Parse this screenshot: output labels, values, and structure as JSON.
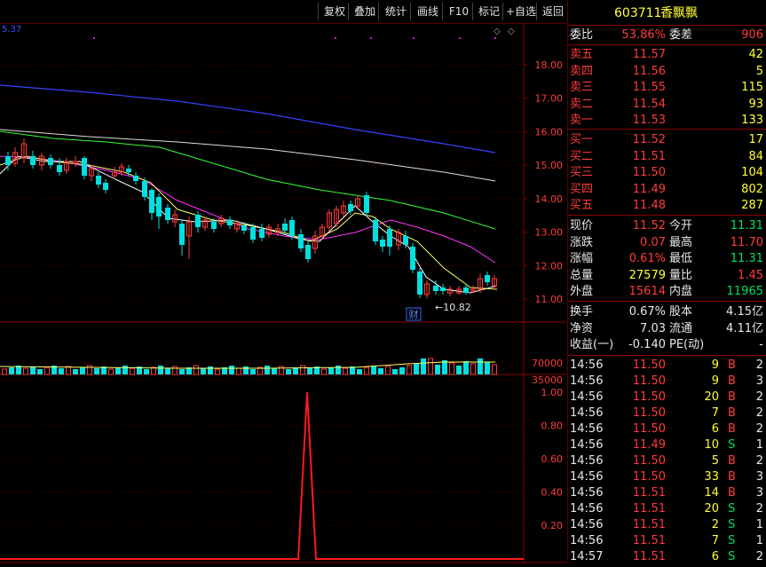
{
  "toolbar": {
    "buttons": [
      "复权",
      "叠加",
      "统计",
      "画线",
      "F10",
      "标记",
      "+自选",
      "返回"
    ]
  },
  "chart": {
    "top_left_value": "5.37",
    "price_axis": [
      "18.00",
      "17.00",
      "16.00",
      "15.00",
      "14.00",
      "13.00",
      "12.00",
      "11.00"
    ],
    "low_annotation": "←10.82",
    "cai_badge": "财",
    "volume_axis": [
      "70000",
      "35000"
    ],
    "indicator_axis": [
      "1.00",
      "0.80",
      "0.60",
      "0.40",
      "0.20"
    ]
  },
  "stock": {
    "code": "603711",
    "name": "香飘飘"
  },
  "order_ratio": {
    "label1": "委比",
    "value1": "53.86%",
    "label2": "委差",
    "value2": "906"
  },
  "asks": [
    {
      "label": "卖五",
      "price": "11.57",
      "volume": "42"
    },
    {
      "label": "卖四",
      "price": "11.56",
      "volume": "5"
    },
    {
      "label": "卖三",
      "price": "11.55",
      "volume": "115"
    },
    {
      "label": "卖二",
      "price": "11.54",
      "volume": "93"
    },
    {
      "label": "卖一",
      "price": "11.53",
      "volume": "133"
    }
  ],
  "bids": [
    {
      "label": "买一",
      "price": "11.52",
      "volume": "17"
    },
    {
      "label": "买二",
      "price": "11.51",
      "volume": "84"
    },
    {
      "label": "买三",
      "price": "11.50",
      "volume": "104"
    },
    {
      "label": "买四",
      "price": "11.49",
      "volume": "802"
    },
    {
      "label": "买五",
      "price": "11.48",
      "volume": "287"
    }
  ],
  "quote": [
    {
      "l1": "现价",
      "v1": "11.52",
      "l2": "今开",
      "v2": "11.31"
    },
    {
      "l1": "涨跌",
      "v1": "0.07",
      "l2": "最高",
      "v2": "11.70"
    },
    {
      "l1": "涨幅",
      "v1": "0.61%",
      "l2": "最低",
      "v2": "11.31"
    },
    {
      "l1": "总量",
      "v1": "27579",
      "l2": "量比",
      "v2": "1.45"
    },
    {
      "l1": "外盘",
      "v1": "15614",
      "l2": "内盘",
      "v2": "11965"
    }
  ],
  "fundamentals": [
    {
      "l1": "换手",
      "v1": "0.67%",
      "l2": "股本",
      "v2": "4.15亿"
    },
    {
      "l1": "净资",
      "v1": "7.03",
      "l2": "流通",
      "v2": "4.11亿"
    },
    {
      "l1": "收益(一)",
      "v1": "-0.140",
      "l2": "PE(动)",
      "v2": "-"
    }
  ],
  "trades": [
    {
      "time": "14:56",
      "price": "11.50",
      "vol": "9",
      "side": "B",
      "n": "2"
    },
    {
      "time": "14:56",
      "price": "11.50",
      "vol": "9",
      "side": "B",
      "n": "3"
    },
    {
      "time": "14:56",
      "price": "11.50",
      "vol": "20",
      "side": "B",
      "n": "2"
    },
    {
      "time": "14:56",
      "price": "11.50",
      "vol": "7",
      "side": "B",
      "n": "2"
    },
    {
      "time": "14:56",
      "price": "11.50",
      "vol": "6",
      "side": "B",
      "n": "2"
    },
    {
      "time": "14:56",
      "price": "11.49",
      "vol": "10",
      "side": "S",
      "n": "1"
    },
    {
      "time": "14:56",
      "price": "11.50",
      "vol": "5",
      "side": "B",
      "n": "2"
    },
    {
      "time": "14:56",
      "price": "11.50",
      "vol": "33",
      "side": "B",
      "n": "3"
    },
    {
      "time": "14:56",
      "price": "11.51",
      "vol": "14",
      "side": "B",
      "n": "3"
    },
    {
      "time": "14:56",
      "price": "11.51",
      "vol": "20",
      "side": "S",
      "n": "2"
    },
    {
      "time": "14:56",
      "price": "11.51",
      "vol": "2",
      "side": "S",
      "n": "1"
    },
    {
      "time": "14:56",
      "price": "11.51",
      "vol": "7",
      "side": "S",
      "n": "1"
    },
    {
      "time": "14:57",
      "price": "11.51",
      "vol": "6",
      "side": "S",
      "n": "2"
    }
  ],
  "colors": {
    "up": "#ff3b3b",
    "down": "#00e0e0",
    "ma_white": "#ffffff",
    "ma_yellow": "#ffff66",
    "ma_magenta": "#ff33ff",
    "ma_green": "#33ff33",
    "ma_blue": "#3344ff",
    "ma_gray": "#dddddd"
  }
}
